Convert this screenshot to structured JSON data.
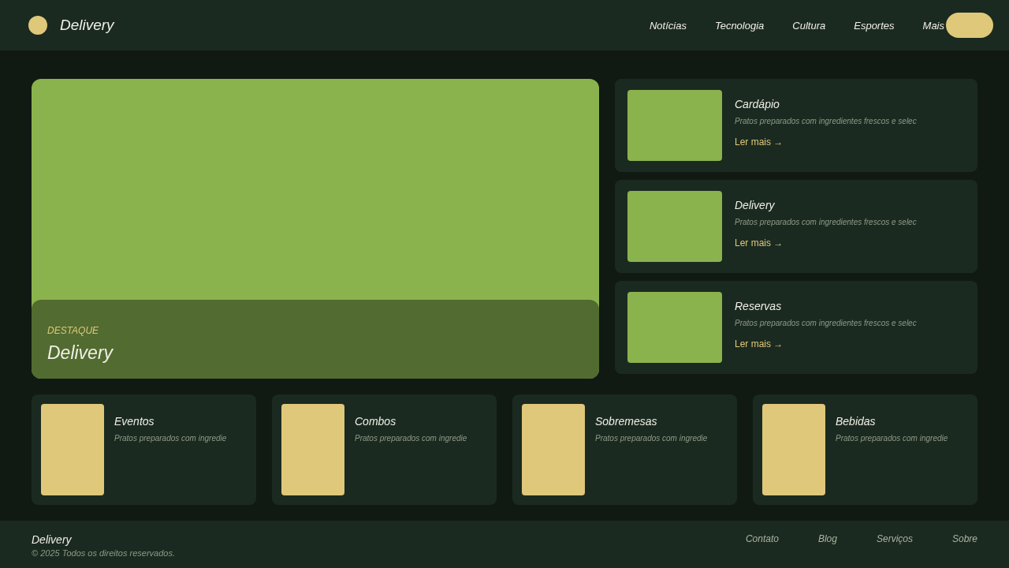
{
  "header": {
    "brand": "Delivery",
    "nav": [
      "Notícias",
      "Tecnologia",
      "Cultura",
      "Esportes",
      "Mais"
    ]
  },
  "hero": {
    "kicker": "DESTAQUE",
    "title": "Delivery"
  },
  "side_cards": [
    {
      "title": "Cardápio",
      "text": "Pratos preparados com ingredientes frescos e selec",
      "link": "Ler mais →"
    },
    {
      "title": "Delivery",
      "text": "Pratos preparados com ingredientes frescos e selec",
      "link": "Ler mais →"
    },
    {
      "title": "Reservas",
      "text": "Pratos preparados com ingredientes frescos e selec",
      "link": "Ler mais →"
    }
  ],
  "bottom_cards": [
    {
      "title": "Eventos",
      "text": "Pratos preparados com ingredie"
    },
    {
      "title": "Combos",
      "text": "Pratos preparados com ingredie"
    },
    {
      "title": "Sobremesas",
      "text": "Pratos preparados com ingredie"
    },
    {
      "title": "Bebidas",
      "text": "Pratos preparados com ingredie"
    }
  ],
  "footer": {
    "brand": "Delivery",
    "copyright": "© 2025 Todos os direitos reservados.",
    "links": [
      "Contato",
      "Blog",
      "Serviços",
      "Sobre"
    ]
  }
}
